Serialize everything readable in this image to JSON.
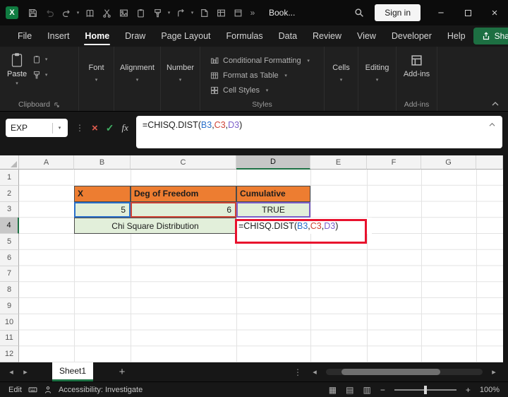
{
  "colors": {
    "excel_green_accent": "#1E7145",
    "share_button_green": "#1d6f42",
    "table_header_fill": "#ED7D31",
    "table_value_fill": "#E2EFDA",
    "reference_1": "#2a6fc9",
    "reference_2": "#cf4335",
    "reference_3": "#7c5fc9",
    "annotation_box_red": "#e8112d"
  },
  "title_bar": {
    "document_title": "Book...",
    "sign_in_label": "Sign in"
  },
  "menu_bar": {
    "items": [
      "File",
      "Insert",
      "Home",
      "Draw",
      "Page Layout",
      "Formulas",
      "Data",
      "Review",
      "View",
      "Developer",
      "Help"
    ],
    "active_item": "Home",
    "share_label": "Share"
  },
  "ribbon": {
    "paste_label": "Paste",
    "clipboard_group_label": "Clipboard",
    "font_group_label": "Font",
    "alignment_group_label": "Alignment",
    "number_group_label": "Number",
    "styles_items": [
      "Conditional Formatting",
      "Format as Table",
      "Cell Styles"
    ],
    "styles_group_label": "Styles",
    "cells_group_label": "Cells",
    "editing_group_label": "Editing",
    "addins_button_label": "Add-ins",
    "addins_group_label": "Add-ins"
  },
  "formula": {
    "name_box_value": "EXP",
    "full_text": "=CHISQ.DIST(B3,C3,D3)",
    "parts": [
      {
        "text": "=CHISQ.DIST(",
        "color": "#1c1c1c"
      },
      {
        "text": "B3",
        "color": "#2a6fc9"
      },
      {
        "text": ",",
        "color": "#1c1c1c"
      },
      {
        "text": "C3",
        "color": "#cf4335"
      },
      {
        "text": ",",
        "color": "#1c1c1c"
      },
      {
        "text": "D3",
        "color": "#7c5fc9"
      },
      {
        "text": ")",
        "color": "#1c1c1c"
      }
    ]
  },
  "grid": {
    "columns": [
      "A",
      "B",
      "C",
      "D",
      "E",
      "F",
      "G"
    ],
    "active_column": "D",
    "rows": [
      "1",
      "2",
      "3",
      "4",
      "5",
      "6",
      "7",
      "8",
      "9",
      "10",
      "11",
      "12"
    ],
    "active_row": "4",
    "cells": {
      "b2": "X",
      "c2": "Deg of Freedom",
      "d2": "Cumulative",
      "b3": "5",
      "c3": "6",
      "d3": "TRUE",
      "b4": "Chi Square Distribution"
    }
  },
  "sheet_bar": {
    "tabs": [
      "Sheet1"
    ],
    "active_tab": "Sheet1"
  },
  "status_bar": {
    "mode": "Edit",
    "accessibility_label": "Accessibility: Investigate",
    "zoom_level": "100%"
  }
}
